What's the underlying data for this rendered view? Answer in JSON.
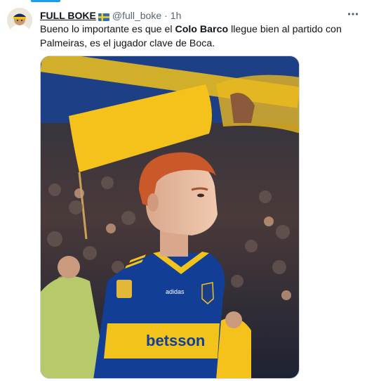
{
  "tweet": {
    "author_name": "FULL BOKE",
    "author_handle": "@full_boke",
    "separator": "·",
    "time": "1h",
    "text_part1": "Bueno lo importante es que el ",
    "text_bold": "Colo Barco",
    "text_part2": " llegue bien al partido con Palmeiras, es el jugador clave de Boca.",
    "more_icon": "more-horizontal-icon",
    "flag_icon": "sweden-flag-icon"
  },
  "media": {
    "shirt_sponsor": "betsson",
    "shirt_brand": "adidas"
  },
  "colors": {
    "accent": "#1d9bf0",
    "boca_blue": "#0b3a8c",
    "boca_gold": "#f5c400"
  }
}
